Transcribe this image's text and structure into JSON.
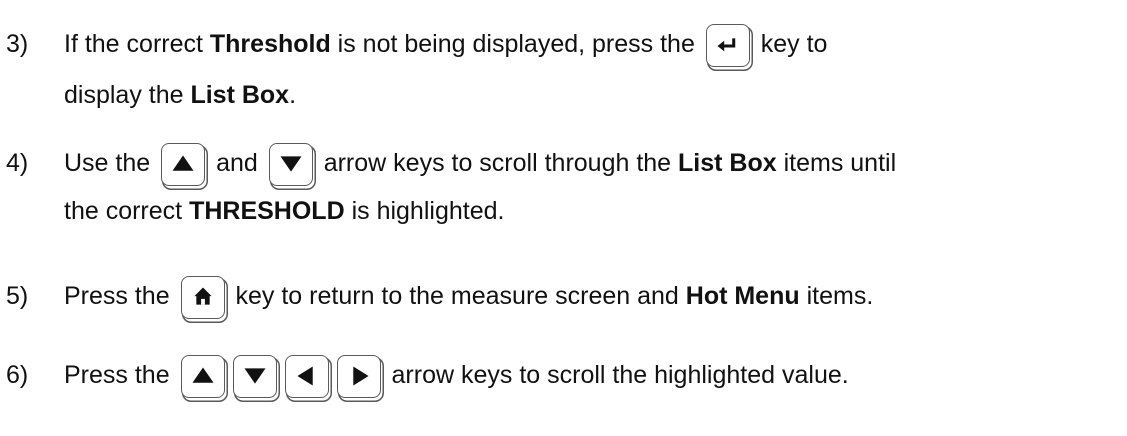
{
  "steps": [
    {
      "number": "3)",
      "t1": "If the correct ",
      "b1": "Threshold",
      "t2": " is not being displayed, press the",
      "t3": "key to",
      "t4": "display the ",
      "b2": "List Box",
      "t5": "."
    },
    {
      "number": "4)",
      "t1": "Use the",
      "t2": "and",
      "t3": "arrow keys to scroll through the ",
      "b1": "List Box",
      "t4": " items until",
      "t5": "the correct ",
      "b2": "THRESHOLD",
      "t6": " is highlighted."
    },
    {
      "number": "5)",
      "t1": "Press the",
      "t2": "key to return to the measure screen and ",
      "b1": "Hot Menu",
      "t3": " items."
    },
    {
      "number": "6)",
      "t1": "Press the",
      "t2": "arrow keys to scroll the highlighted value."
    }
  ],
  "icons": {
    "enter": "enter-key-icon",
    "up": "up-arrow-key-icon",
    "down": "down-arrow-key-icon",
    "left": "left-arrow-key-icon",
    "right": "right-arrow-key-icon",
    "home": "home-key-icon"
  },
  "colors": {
    "text": "#111111",
    "key_border": "#5a5a5a"
  }
}
